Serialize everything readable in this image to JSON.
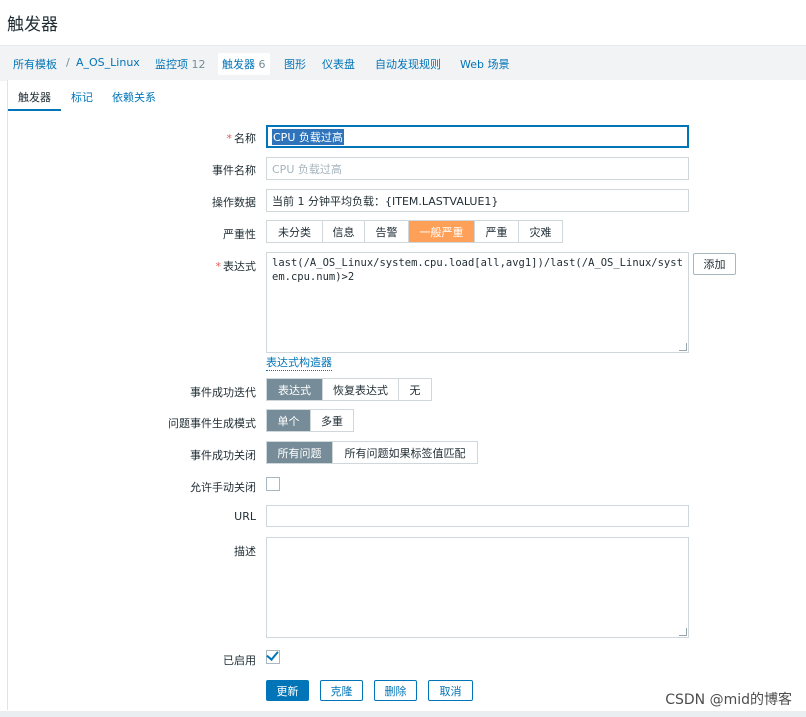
{
  "page": {
    "title": "触发器"
  },
  "nav": {
    "all_templates": "所有模板",
    "separator": "/",
    "template": "A_OS_Linux",
    "items_label": "监控项",
    "items_count": "12",
    "triggers_label": "触发器",
    "triggers_count": "6",
    "graphs": "图形",
    "dashboards": "仪表盘",
    "discovery": "自动发现规则",
    "web": "Web 场景"
  },
  "tabs": [
    "触发器",
    "标记",
    "依赖关系"
  ],
  "form": {
    "name": {
      "label": "名称",
      "value": "CPU 负载过高"
    },
    "event_name": {
      "label": "事件名称",
      "placeholder": "CPU 负载过高"
    },
    "opdata": {
      "label": "操作数据",
      "value": "当前 1 分钟平均负载：{ITEM.LASTVALUE1}"
    },
    "severity": {
      "label": "严重性",
      "options": [
        "未分类",
        "信息",
        "告警",
        "一般严重",
        "严重",
        "灾难"
      ],
      "selected": "一般严重",
      "selected_color": "#ffa059"
    },
    "expression": {
      "label": "表达式",
      "value": "last(/A_OS_Linux/system.cpu.load[all,avg1])/last(/A_OS_Linux/system.cpu.num)>2",
      "add_button": "添加",
      "constructor_link": "表达式构造器"
    },
    "ok_event": {
      "label": "事件成功迭代",
      "options": [
        "表达式",
        "恢复表达式",
        "无"
      ],
      "selected": "表达式"
    },
    "problem_mode": {
      "label": "问题事件生成模式",
      "options": [
        "单个",
        "多重"
      ],
      "selected": "单个"
    },
    "ok_close": {
      "label": "事件成功关闭",
      "options": [
        "所有问题",
        "所有问题如果标签值匹配"
      ],
      "selected": "所有问题"
    },
    "manual_close": {
      "label": "允许手动关闭",
      "checked": false
    },
    "url": {
      "label": "URL",
      "value": ""
    },
    "description": {
      "label": "描述",
      "value": ""
    },
    "enabled": {
      "label": "已启用",
      "checked": true
    },
    "buttons": {
      "update": "更新",
      "clone": "克隆",
      "delete": "删除",
      "cancel": "取消"
    }
  },
  "colors": {
    "accent": "#0275b8",
    "selected_gray": "#768d99",
    "severity_average": "#ffa059"
  },
  "credit": "CSDN @mid的博客"
}
